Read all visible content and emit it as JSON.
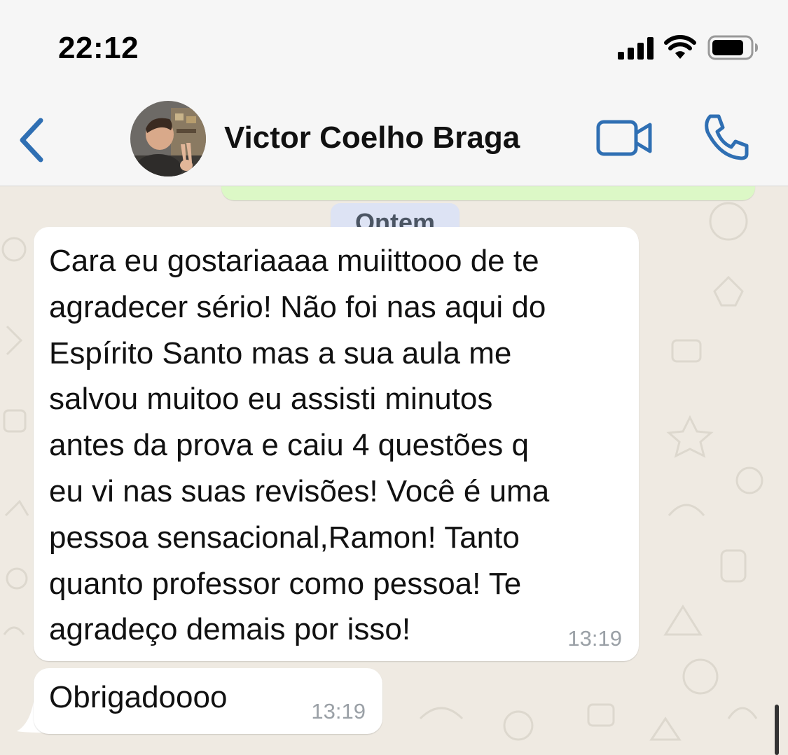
{
  "status_bar": {
    "time": "22:12",
    "signal_icon": "cellular-signal-icon",
    "wifi_icon": "wifi-icon",
    "battery_icon": "battery-icon"
  },
  "header": {
    "back_icon": "chevron-left-icon",
    "contact_name": "Victor Coelho Braga",
    "avatar": "contact-avatar-photo",
    "video_icon": "video-camera-icon",
    "phone_icon": "phone-icon",
    "accent_color": "#2f6fb3"
  },
  "chat": {
    "date_separator": "Ontem",
    "messages": [
      {
        "direction": "incoming",
        "text": "Cara eu gostariaaaa muiittooo de te\nagradecer sério! Não foi nas aqui do\nEspírito Santo mas a sua aula me\nsalvou muitoo eu assisti minutos\nantes da prova e caiu 4 questões q\neu vi nas suas revisões! Você é uma\npessoa sensacional,Ramon! Tanto\nquanto professor como pessoa! Te\nagradeço demais por isso!",
        "time": "13:19"
      },
      {
        "direction": "incoming",
        "text": "Obrigadoooo",
        "time": "13:19"
      }
    ],
    "incoming_bubble_color": "#ffffff",
    "outgoing_bubble_color": "#dcf8c6",
    "wallpaper_color": "#efeae2"
  }
}
